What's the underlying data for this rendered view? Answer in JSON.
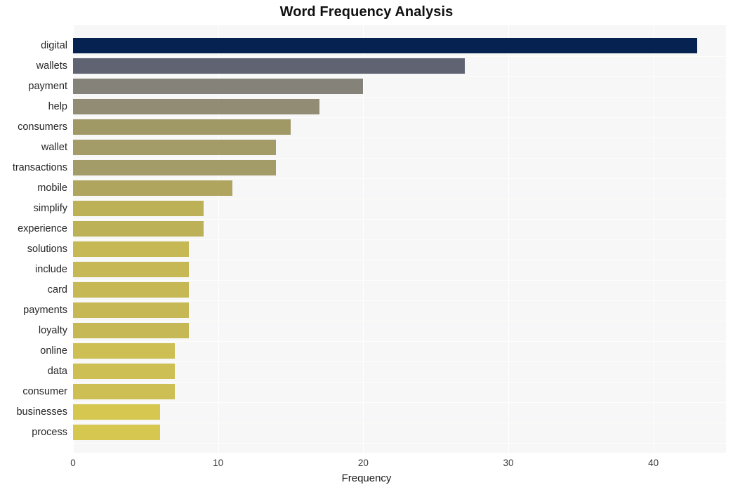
{
  "chart_data": {
    "type": "bar",
    "orientation": "horizontal",
    "title": "Word Frequency Analysis",
    "xlabel": "Frequency",
    "ylabel": "",
    "categories": [
      "digital",
      "wallets",
      "payment",
      "help",
      "consumers",
      "wallet",
      "transactions",
      "mobile",
      "simplify",
      "experience",
      "solutions",
      "include",
      "card",
      "payments",
      "loyalty",
      "online",
      "data",
      "consumer",
      "businesses",
      "process"
    ],
    "values": [
      43,
      27,
      20,
      17,
      15,
      14,
      14,
      11,
      9,
      9,
      8,
      8,
      8,
      8,
      8,
      7,
      7,
      7,
      6,
      6
    ],
    "bar_colors": [
      "#052250",
      "#5f6372",
      "#858379",
      "#928c74",
      "#a09865",
      "#a39b68",
      "#a39b68",
      "#afa55f",
      "#bdb158",
      "#bdb158",
      "#c6b955",
      "#c6b955",
      "#c6b955",
      "#c6b955",
      "#c6b955",
      "#cdbf53",
      "#cdbf53",
      "#cdbf53",
      "#d6c751",
      "#d6c751"
    ],
    "xlim": [
      0,
      45
    ],
    "xticks": [
      0,
      10,
      20,
      30,
      40
    ],
    "xtick_labels": [
      "0",
      "10",
      "20",
      "30",
      "40"
    ],
    "grid": true,
    "legend": "none",
    "plot_background": "#f7f7f7"
  }
}
